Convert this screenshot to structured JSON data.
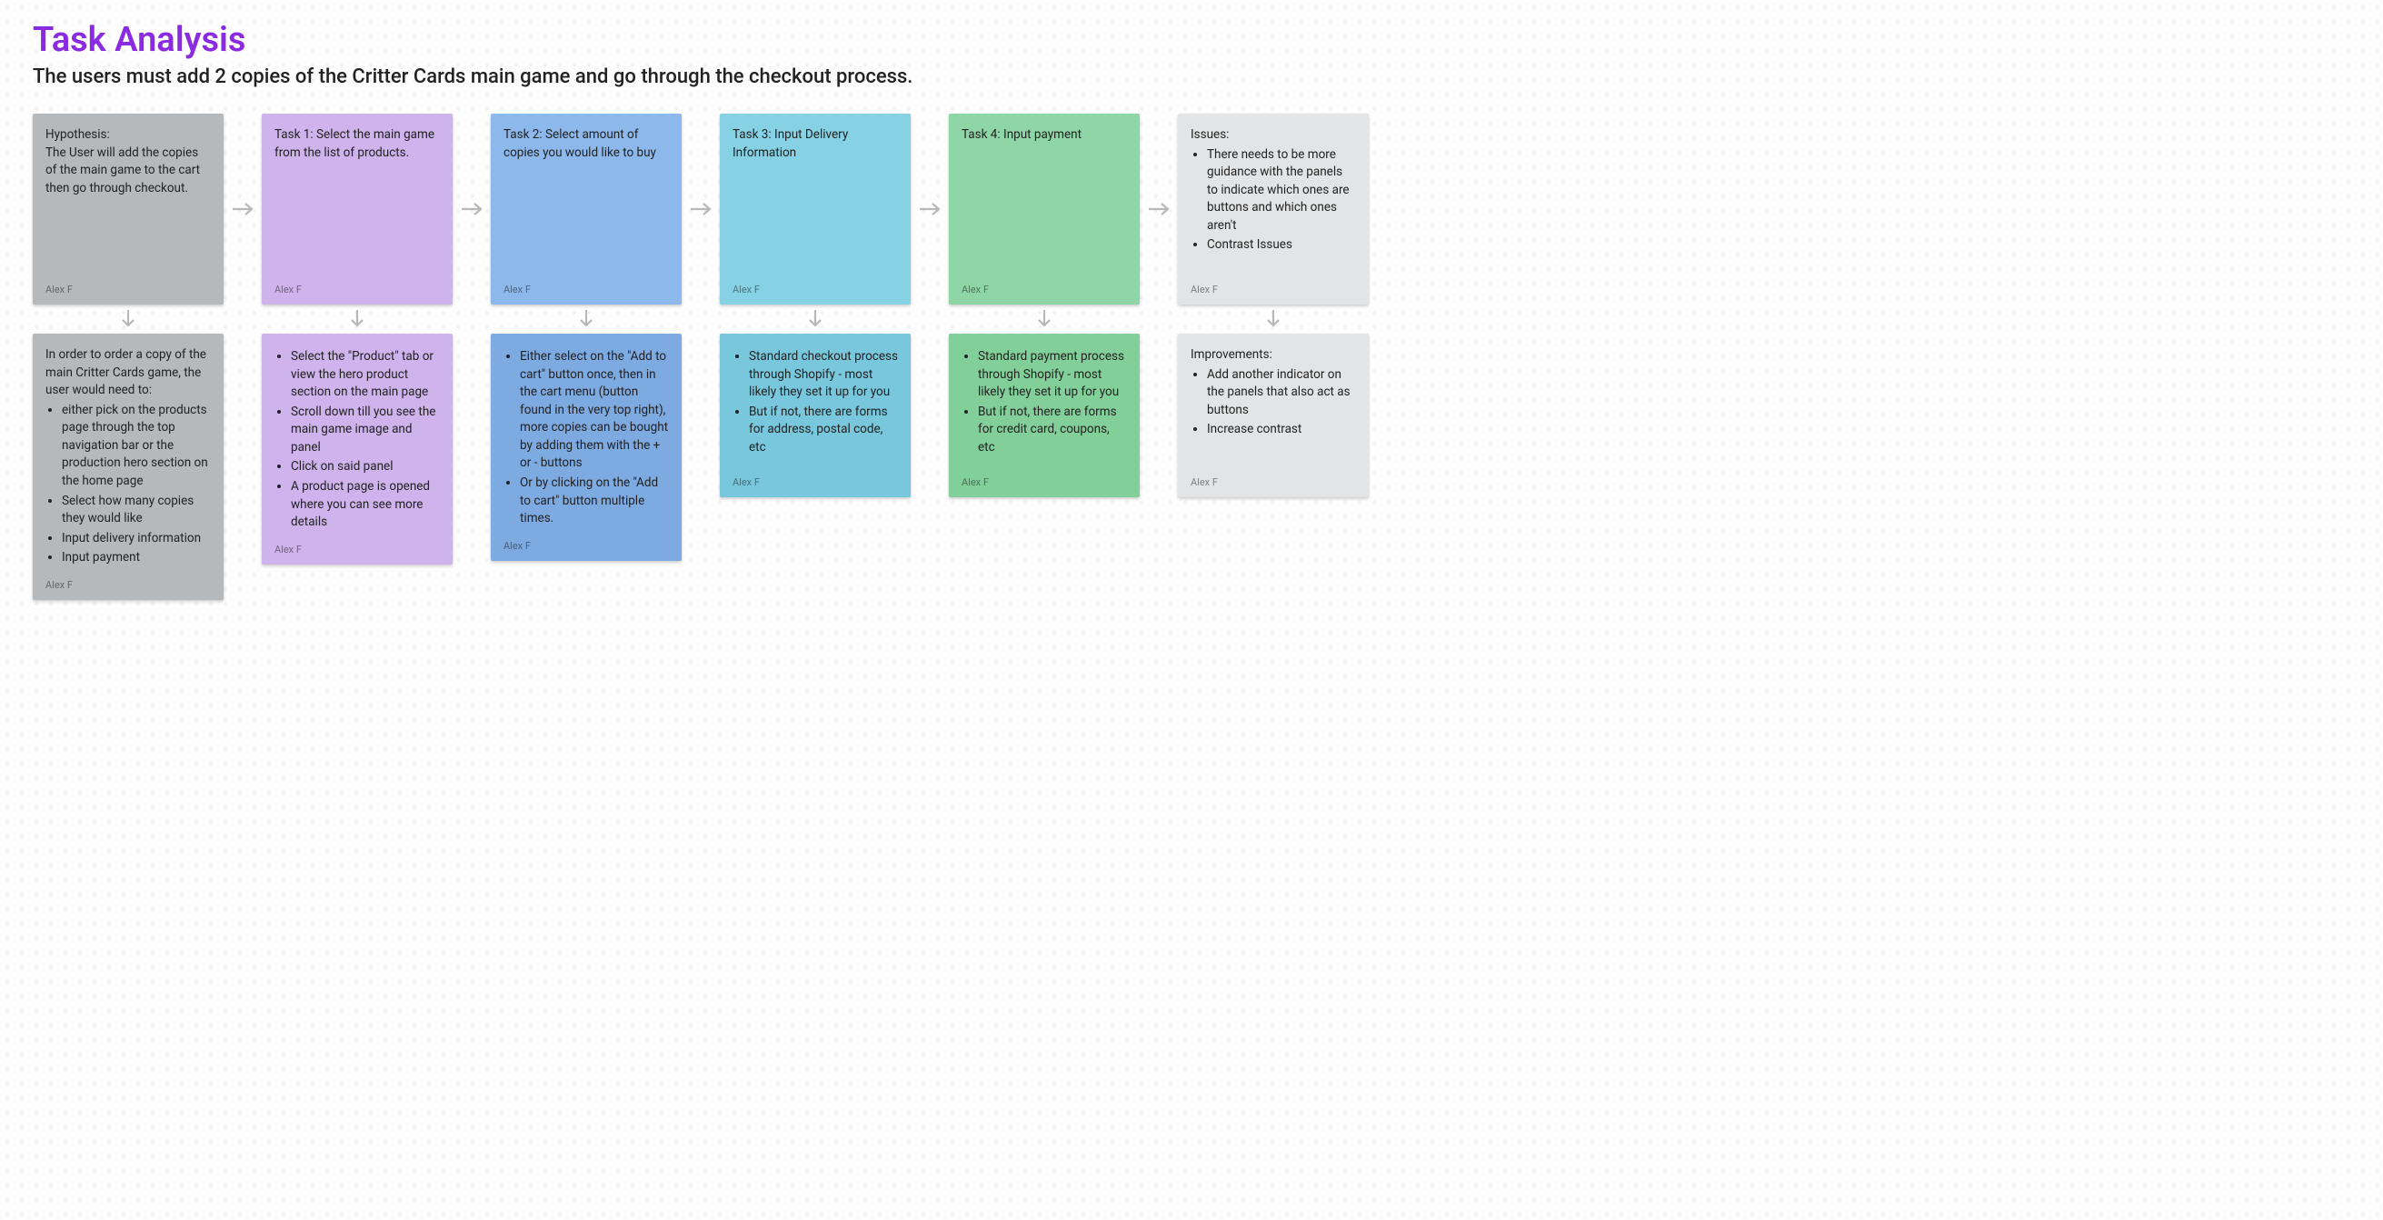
{
  "header": {
    "title": "Task Analysis",
    "subtitle": "The users must add 2 copies of the Critter Cards main game and go through the checkout process."
  },
  "author": "Alex F",
  "columns": [
    {
      "top": {
        "color": "c-grey",
        "text": "Hypothesis:\nThe User will add the copies of the main game to the cart then go through checkout."
      },
      "bottom": {
        "color": "c-grey",
        "lead": "In order to order a copy of the main Critter Cards game, the user would need to:",
        "bullets": [
          "either pick on the products page through the top navigation bar or the production hero section on the home page",
          "Select how many copies they would like",
          "Input delivery information",
          "Input payment"
        ]
      }
    },
    {
      "top": {
        "color": "c-purple",
        "text": "Task 1: Select the main game from the list of products."
      },
      "bottom": {
        "color": "c-purple",
        "bullets": [
          "Select the \"Product\" tab or view the hero product section on the main page",
          "Scroll down till you see the main game image and panel",
          "Click on said panel",
          "A product page is opened where you can see more details"
        ]
      }
    },
    {
      "top": {
        "color": "c-blue",
        "text": "Task 2: Select amount of copies you would like to buy"
      },
      "bottom": {
        "color": "c-blue-d",
        "bullets": [
          "Either select on the \"Add to cart\" button once, then in the cart menu (button found in the very top right), more copies can be bought by adding them with the + or - buttons",
          "Or by clicking on the \"Add to cart\" button multiple times."
        ]
      }
    },
    {
      "top": {
        "color": "c-cyan",
        "text": "Task 3: Input Delivery Information"
      },
      "bottom": {
        "color": "c-cyan-d",
        "bullets": [
          "Standard checkout process through Shopify - most likely they set it up for you",
          "But if not, there are forms for address, postal code, etc"
        ]
      }
    },
    {
      "top": {
        "color": "c-green",
        "text": "Task 4: Input payment"
      },
      "bottom": {
        "color": "c-green-d",
        "bullets": [
          "Standard payment process through Shopify - most likely they set it up for you",
          "But if not, there are forms for credit card, coupons, etc"
        ]
      }
    },
    {
      "top": {
        "color": "c-light",
        "lead": "Issues:",
        "bullets": [
          "There needs to be more guidance with the panels to indicate which ones are buttons and which ones aren't",
          "Contrast Issues"
        ]
      },
      "bottom": {
        "color": "c-light",
        "lead": "Improvements:",
        "bullets": [
          "Add another indicator on the panels that also act as buttons",
          "Increase contrast"
        ]
      }
    }
  ]
}
